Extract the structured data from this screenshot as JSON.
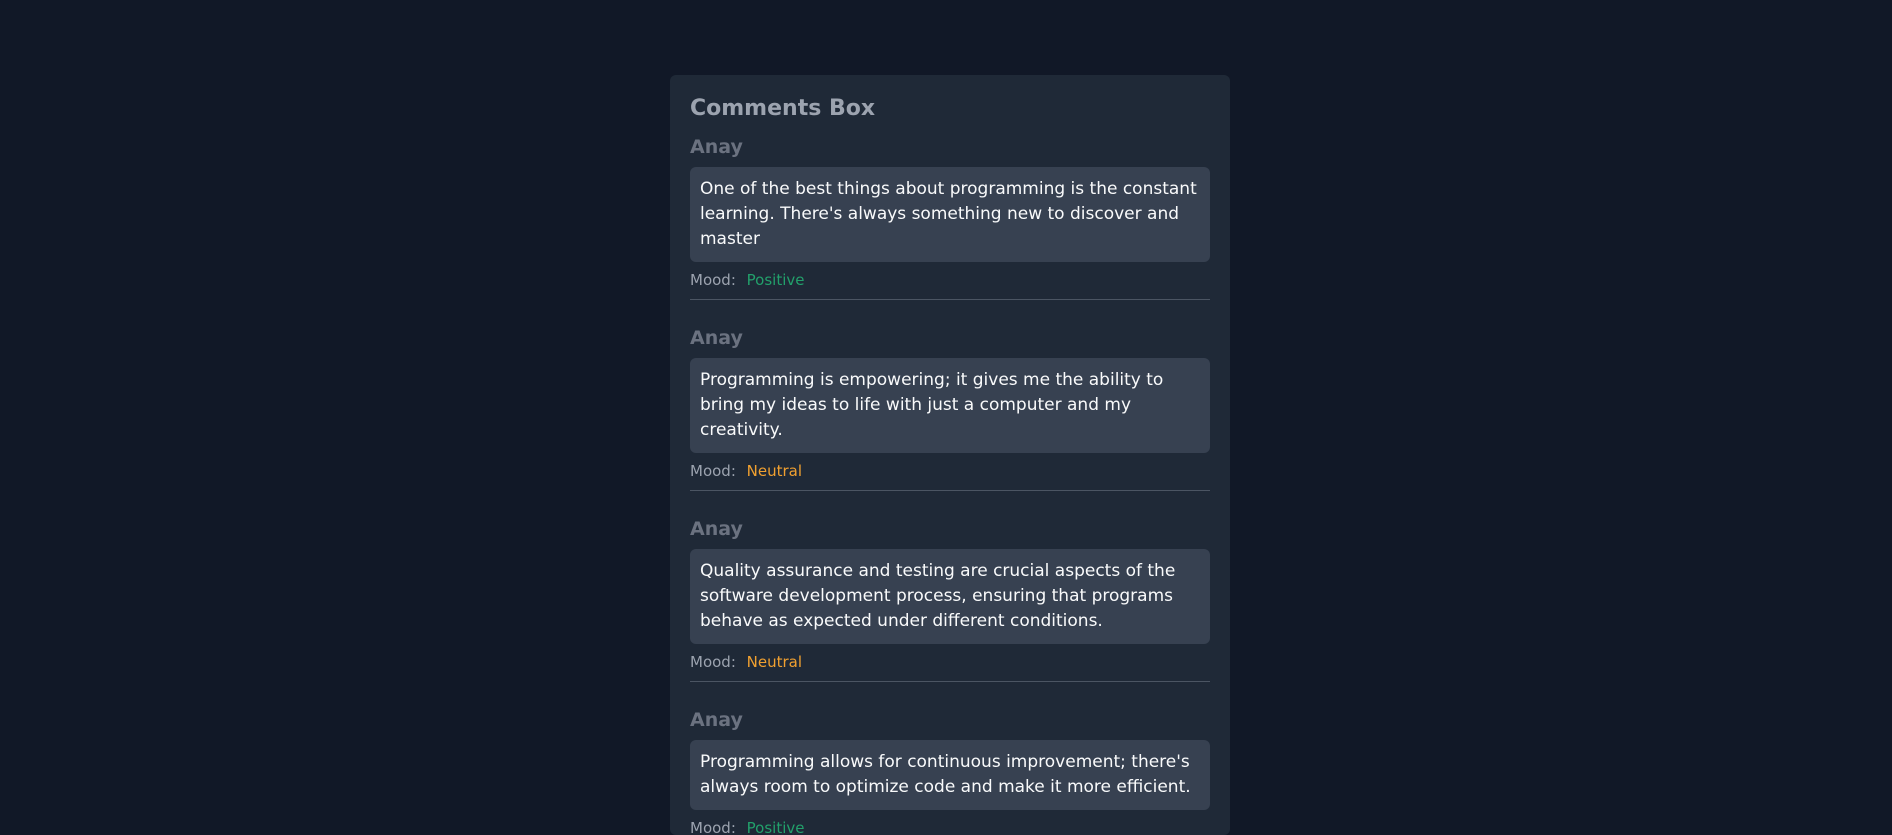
{
  "panel": {
    "title": "Comments Box"
  },
  "comments": [
    {
      "author": "Anay",
      "text": "One of the best things about programming is the constant learning. There's always something new to discover and master",
      "mood_label": "Mood:",
      "mood": "Positive"
    },
    {
      "author": "Anay",
      "text": "Programming is empowering; it gives me the ability to bring my ideas to life with just a computer and my creativity.",
      "mood_label": "Mood:",
      "mood": "Neutral"
    },
    {
      "author": "Anay",
      "text": "Quality assurance and testing are crucial aspects of the software development process, ensuring that programs behave as expected under different conditions.",
      "mood_label": "Mood:",
      "mood": "Neutral"
    },
    {
      "author": "Anay",
      "text": "Programming allows for continuous improvement; there's always room to optimize code and make it more efficient.",
      "mood_label": "Mood:",
      "mood": "Positive"
    }
  ],
  "colors": {
    "background": "#111827",
    "panel": "#1f2937",
    "bubble": "#374151",
    "positive": "#22a06b",
    "neutral": "#f0a030"
  }
}
